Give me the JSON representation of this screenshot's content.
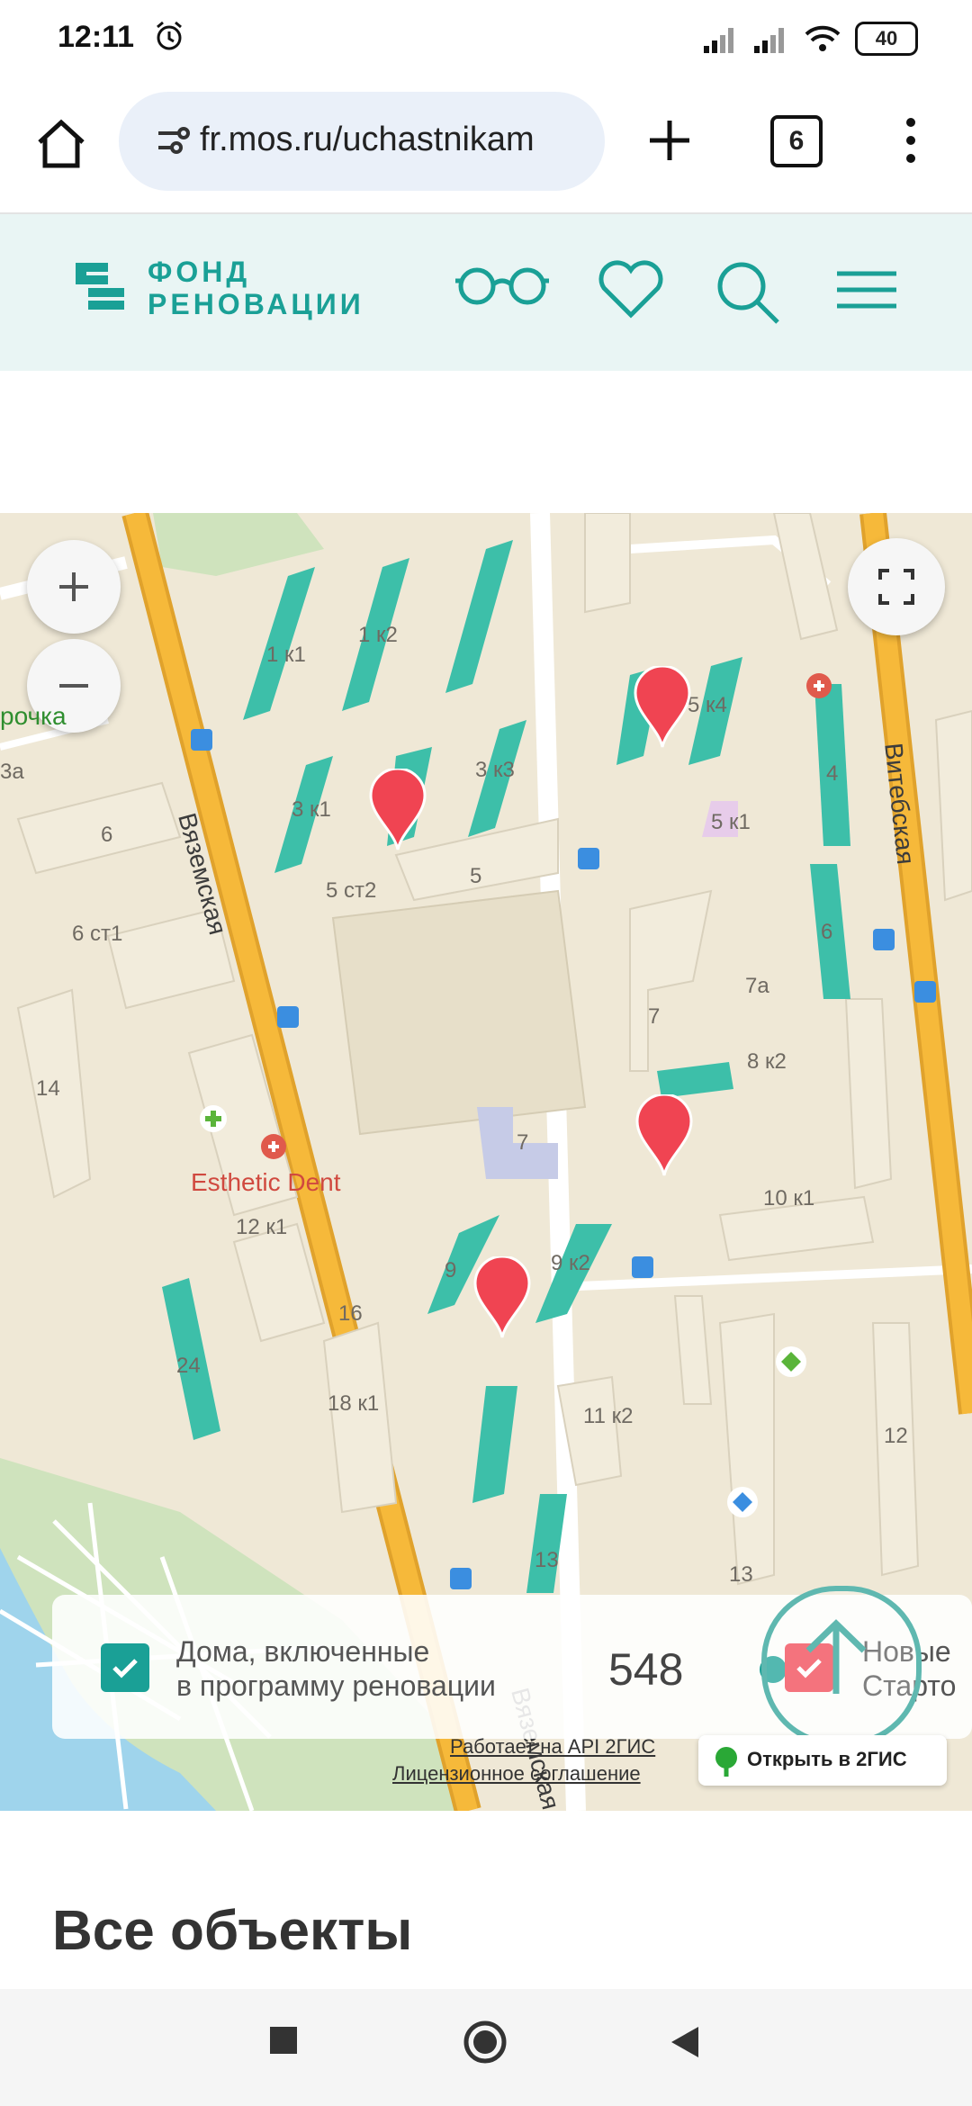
{
  "status_bar": {
    "time": "12:11",
    "battery": "40"
  },
  "browser": {
    "url": "fr.mos.ru/uchastnikam",
    "tab_count": "6"
  },
  "site": {
    "logo_line1": "ФОНД",
    "logo_line2": "РЕНОВАЦИИ"
  },
  "map": {
    "streets": [
      "Вяземская",
      "Витебская",
      "Вяземская"
    ],
    "poi_labels": [
      "рочка",
      "Esthetic Dent"
    ],
    "building_labels": [
      "1 к1",
      "1 к2",
      "3 к1",
      "3 к3",
      "5 ст2",
      "5",
      "6",
      "6 ст1",
      "4",
      "5 к4",
      "5 к1",
      "6",
      "7",
      "7а",
      "8 к2",
      "7",
      "14",
      "12 к1",
      "9",
      "9 к2",
      "10 к1",
      "16",
      "24",
      "18 к1",
      "11 к2",
      "12",
      "13",
      "13",
      "3а"
    ],
    "attribution_api": "Работает на API 2ГИС",
    "attribution_license": "Лицензионное соглашение",
    "open_2gis": "Открыть в 2ГИС"
  },
  "legend": {
    "item1_line1": "Дома, включенные",
    "item1_line2": "в программу реновации",
    "count": "548",
    "item2_line1": "Новые",
    "item2_line2": "Старто"
  },
  "section": {
    "title": "Все объекты"
  },
  "colors": {
    "brand": "#1aa096",
    "pin": "#f04452",
    "building_teal": "#3dbfa9",
    "road": "#f5b331"
  }
}
